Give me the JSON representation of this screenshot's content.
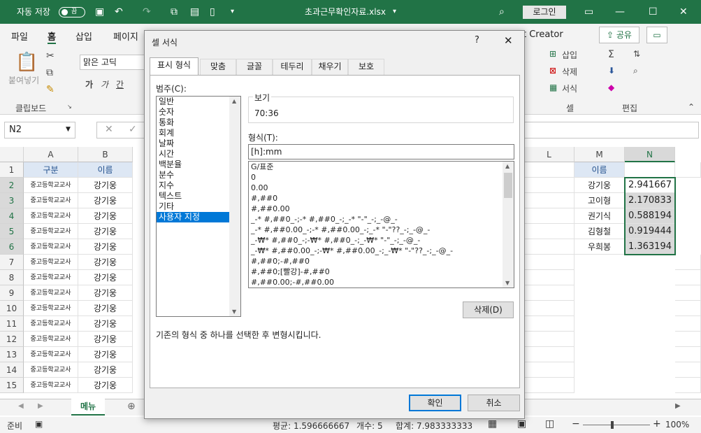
{
  "titlebar": {
    "autosave": "자동 저장",
    "toggle": "끔",
    "filename": "초과근무확인자료.xlsx",
    "login": "로그인"
  },
  "tabs": [
    "파일",
    "홈",
    "삽입",
    "페이지",
    "t Creator"
  ],
  "ribbon": {
    "paste": "붙여넣기",
    "clipboard": "클립보드",
    "font": "맑은 고딕",
    "bold": "가",
    "italic": "가",
    "underline": "간",
    "insert": "삽입",
    "delete": "삭제",
    "format": "서식",
    "cells": "셀",
    "editing": "편집",
    "share": "공유"
  },
  "namebox": "N2",
  "columns": [
    "A",
    "B",
    "L",
    "M",
    "N"
  ],
  "rows": [
    "1",
    "2",
    "3",
    "4",
    "5",
    "6",
    "7",
    "8",
    "9",
    "10",
    "11",
    "12",
    "13",
    "14",
    "15"
  ],
  "colA_header": "구분",
  "colB_header": "이름",
  "colA_value": "중고등학교교사",
  "colB_value": "강기웅",
  "colM_header": "이름",
  "colM": [
    "강기웅",
    "고이형",
    "권기식",
    "김형철",
    "우희봉"
  ],
  "colN": [
    "2.941667",
    "2.170833",
    "0.588194",
    "0.919444",
    "1.363194"
  ],
  "sheet_tab": "메뉴",
  "status": {
    "ready": "준비",
    "avg": "평균: 1.596666667",
    "count": "개수: 5",
    "sum": "합계: 7.983333333",
    "zoom": "100%"
  },
  "dialog": {
    "title": "셀 서식",
    "help": "?",
    "tabs": [
      "표시 형식",
      "맞춤",
      "글꼴",
      "테두리",
      "채우기",
      "보호"
    ],
    "category_label": "범주(C):",
    "categories": [
      "일반",
      "숫자",
      "통화",
      "회계",
      "날짜",
      "시간",
      "백분율",
      "분수",
      "지수",
      "텍스트",
      "기타",
      "사용자 지정"
    ],
    "sample_label": "보기",
    "sample_value": "70:36",
    "format_label": "형식(T):",
    "format_value": "[h]:mm",
    "formats": [
      "G/표준",
      "0",
      "0.00",
      "#,##0",
      "#,##0.00",
      "_-* #,##0_-;-* #,##0_-;_-* \"-\"_-;_-@_-",
      "_-* #,##0.00_-;-* #,##0.00_-;_-* \"-\"??_-;_-@_-",
      "_-₩* #,##0_-;-₩* #,##0_-;_-₩* \"-\"_-;_-@_-",
      "_-₩* #,##0.00_-;-₩* #,##0.00_-;_-₩* \"-\"??_-;_-@_-",
      "#,##0;-#,##0",
      "#,##0;[빨강]-#,##0",
      "#,##0.00;-#,##0.00"
    ],
    "delete_btn": "삭제(D)",
    "description": "기존의 형식 중 하나를 선택한 후 변형시킵니다.",
    "ok": "확인",
    "cancel": "취소"
  }
}
